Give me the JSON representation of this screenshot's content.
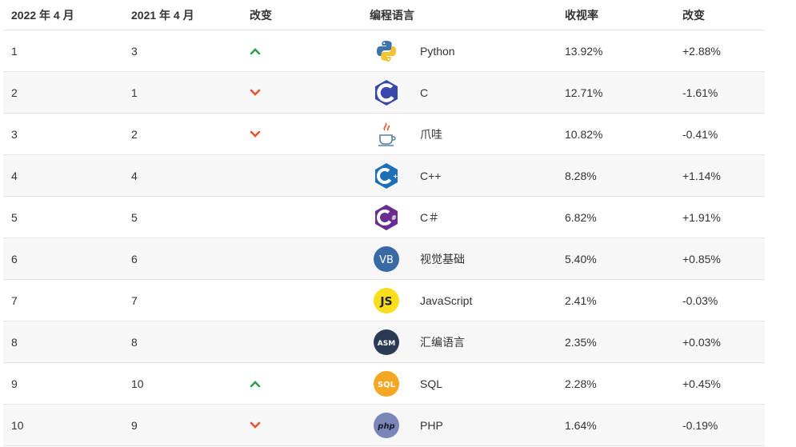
{
  "header": {
    "rank_2022": "2022 年 4 月",
    "rank_2021": "2021 年 4 月",
    "change": "改变",
    "language": "编程语言",
    "rating": "收视率",
    "rating_change": "改变"
  },
  "colors": {
    "up": "#2e9e57",
    "down": "#e8542a",
    "row_alt": "#f7f7f7"
  },
  "rows": [
    {
      "rank_2022": "1",
      "rank_2021": "3",
      "trend": "up",
      "icon": "python-icon",
      "language": "Python",
      "rating": "13.92%",
      "change": "+2.88%"
    },
    {
      "rank_2022": "2",
      "rank_2021": "1",
      "trend": "down",
      "icon": "c-icon",
      "language": "C",
      "rating": "12.71%",
      "change": "-1.61%"
    },
    {
      "rank_2022": "3",
      "rank_2021": "2",
      "trend": "down",
      "icon": "java-icon",
      "language": "爪哇",
      "rating": "10.82%",
      "change": "-0.41%"
    },
    {
      "rank_2022": "4",
      "rank_2021": "4",
      "trend": "",
      "icon": "cpp-icon",
      "language": "C++",
      "rating": "8.28%",
      "change": "+1.14%"
    },
    {
      "rank_2022": "5",
      "rank_2021": "5",
      "trend": "",
      "icon": "csharp-icon",
      "language": "C＃",
      "rating": "6.82%",
      "change": "+1.91%"
    },
    {
      "rank_2022": "6",
      "rank_2021": "6",
      "trend": "",
      "icon": "vb-icon",
      "language": "视觉基础",
      "rating": "5.40%",
      "change": "+0.85%",
      "icon_text": "VB"
    },
    {
      "rank_2022": "7",
      "rank_2021": "7",
      "trend": "",
      "icon": "javascript-icon",
      "language": "JavaScript",
      "rating": "2.41%",
      "change": "-0.03%",
      "icon_text": "JS"
    },
    {
      "rank_2022": "8",
      "rank_2021": "8",
      "trend": "",
      "icon": "asm-icon",
      "language": "汇编语言",
      "rating": "2.35%",
      "change": "+0.03%",
      "icon_text": "ASM"
    },
    {
      "rank_2022": "9",
      "rank_2021": "10",
      "trend": "up",
      "icon": "sql-icon",
      "language": "SQL",
      "rating": "2.28%",
      "change": "+0.45%",
      "icon_text": "SQL"
    },
    {
      "rank_2022": "10",
      "rank_2021": "9",
      "trend": "down",
      "icon": "php-icon",
      "language": "PHP",
      "rating": "1.64%",
      "change": "-0.19%",
      "icon_text": "php"
    }
  ]
}
